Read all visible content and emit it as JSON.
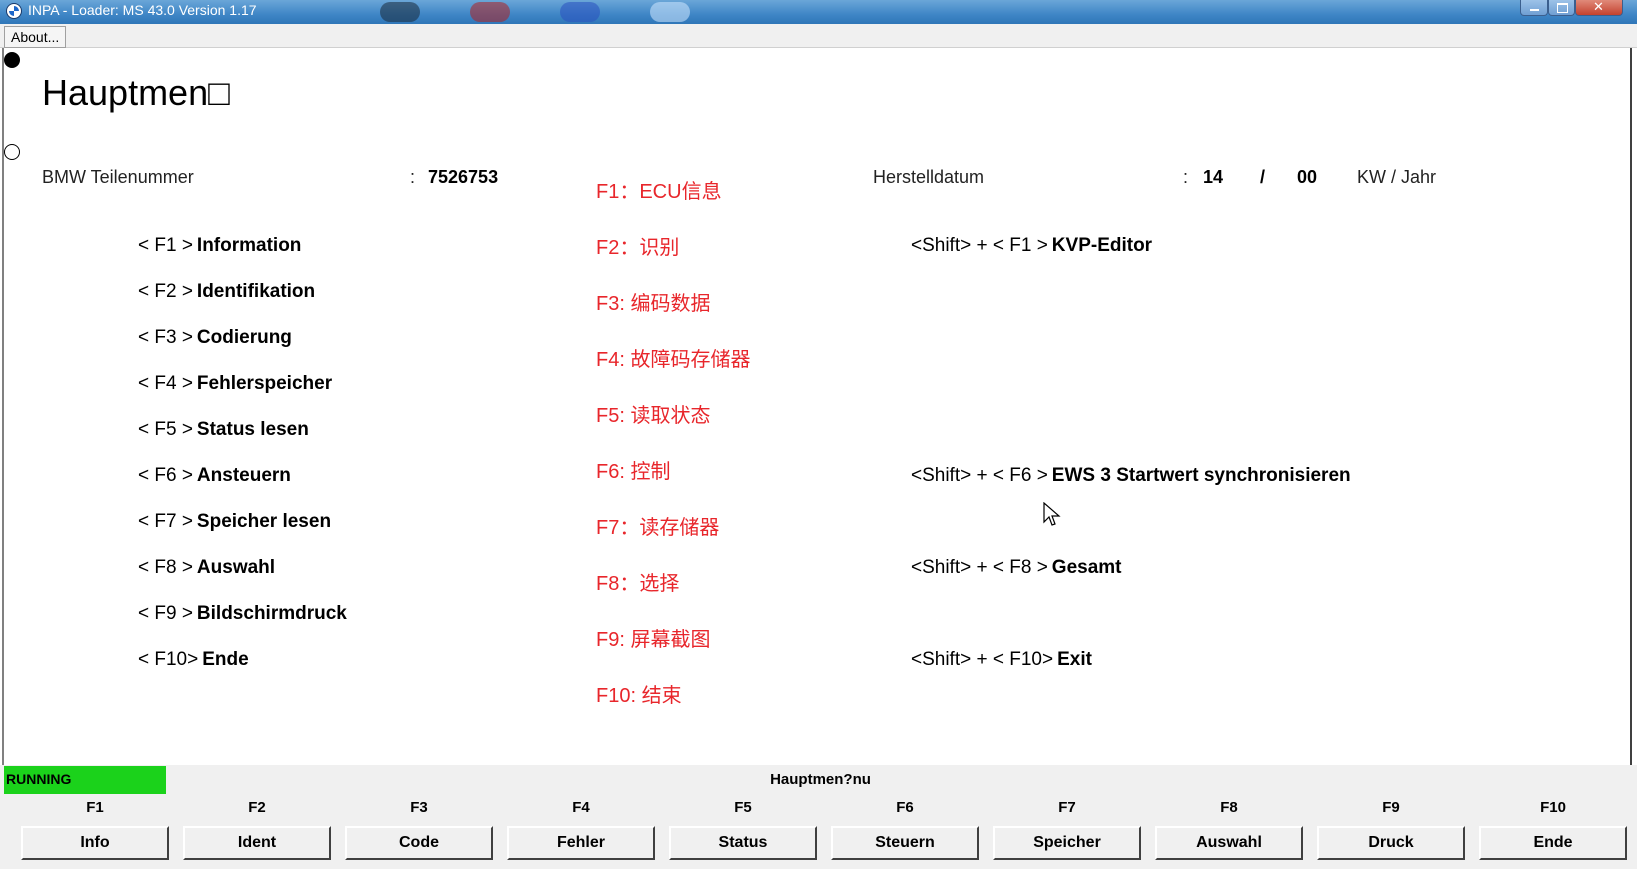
{
  "window": {
    "title": "INPA - Loader:  MS 43.0 Version 1.17"
  },
  "menu": {
    "about": "About..."
  },
  "main": {
    "heading": "Hauptmen□",
    "part_number_label": "BMW Teilenummer",
    "part_number_sep": ":",
    "part_number_value": "7526753",
    "date_label": "Herstelldatum",
    "date_sep": ":",
    "date_week": "14",
    "date_slash": "/",
    "date_year": "00",
    "date_unit": "KW / Jahr"
  },
  "left_keys": [
    {
      "key": "< F1 >",
      "label": "Information"
    },
    {
      "key": "< F2 >",
      "label": "Identifikation"
    },
    {
      "key": "< F3 >",
      "label": "Codierung"
    },
    {
      "key": "< F4 >",
      "label": "Fehlerspeicher"
    },
    {
      "key": "< F5 >",
      "label": "Status lesen"
    },
    {
      "key": "< F6 >",
      "label": "Ansteuern"
    },
    {
      "key": "< F7 >",
      "label": "Speicher lesen"
    },
    {
      "key": "< F8 >",
      "label": "Auswahl"
    },
    {
      "key": "< F9 >",
      "label": "Bildschirmdruck"
    },
    {
      "key": "< F10>",
      "label": "Ende"
    }
  ],
  "right_keys": [
    {
      "key": "<Shift> + < F1 >",
      "label": "KVP-Editor"
    },
    {
      "key": "<Shift> + < F6 >",
      "label": "EWS 3 Startwert synchronisieren"
    },
    {
      "key": "<Shift> + < F8 >",
      "label": "Gesamt"
    },
    {
      "key": "<Shift> + < F10>",
      "label": "Exit"
    }
  ],
  "annotations": [
    "F1：ECU信息",
    "F2：识别",
    "F3: 编码数据",
    "F4: 故障码存储器",
    "F5: 读取状态",
    "F6: 控制",
    "F7：读存储器",
    "F8：选择",
    "F9: 屏幕截图",
    "F10: 结束"
  ],
  "status": {
    "running": "RUNNING",
    "title": "Hauptmen?nu"
  },
  "fkeys": [
    {
      "key": "F1",
      "label": "Info"
    },
    {
      "key": "F2",
      "label": "Ident"
    },
    {
      "key": "F3",
      "label": "Code"
    },
    {
      "key": "F4",
      "label": "Fehler"
    },
    {
      "key": "F5",
      "label": "Status"
    },
    {
      "key": "F6",
      "label": "Steuern"
    },
    {
      "key": "F7",
      "label": "Speicher"
    },
    {
      "key": "F8",
      "label": "Auswahl"
    },
    {
      "key": "F9",
      "label": "Druck"
    },
    {
      "key": "F10",
      "label": "Ende"
    }
  ],
  "colors": {
    "annotation": "#e8262b",
    "running": "#1bd21b",
    "titlebar": "#3f86c6"
  }
}
